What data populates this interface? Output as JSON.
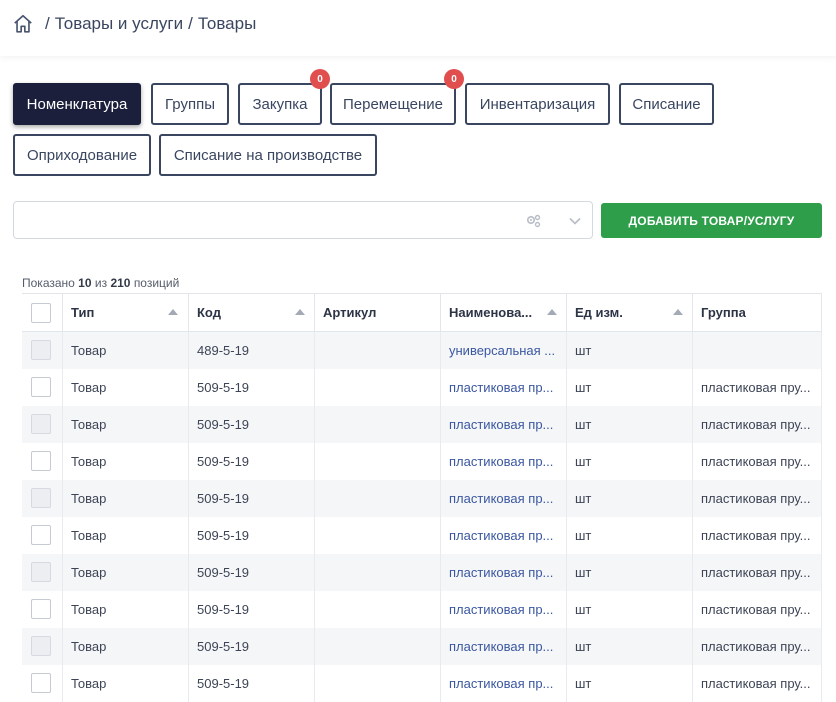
{
  "breadcrumb": {
    "home_icon": "home-icon",
    "parts": [
      "Товары и услуги",
      "Товары"
    ],
    "separator": "/"
  },
  "tabs": [
    {
      "label": "Номенклатура",
      "active": true,
      "badge": null
    },
    {
      "label": "Группы",
      "active": false,
      "badge": null
    },
    {
      "label": "Закупка",
      "active": false,
      "badge": "0"
    },
    {
      "label": "Перемещение",
      "active": false,
      "badge": "0"
    },
    {
      "label": "Инвентаризация",
      "active": false,
      "badge": null
    },
    {
      "label": "Списание",
      "active": false,
      "badge": null
    },
    {
      "label": "Оприходование",
      "active": false,
      "badge": null
    },
    {
      "label": "Списание на производстве",
      "active": false,
      "badge": null
    }
  ],
  "search": {
    "value": "",
    "placeholder": "",
    "settings_icon": "settings-icon",
    "dropdown_icon": "chevron-down-icon"
  },
  "add_button": {
    "label": "ДОБАВИТЬ ТОВАР/УСЛУГУ"
  },
  "summary": {
    "prefix": "Показано",
    "shown": "10",
    "middle": "из",
    "total": "210",
    "suffix": "позиций"
  },
  "colors": {
    "active_tab": "#1b1f3b",
    "add_button": "#2e9e4a",
    "badge": "#e04e4e",
    "link": "#3a57a0"
  },
  "table": {
    "columns": [
      {
        "label": "Тип",
        "sortable": true
      },
      {
        "label": "Код",
        "sortable": true
      },
      {
        "label": "Артикул",
        "sortable": false
      },
      {
        "label": "Наименова...",
        "sortable": true
      },
      {
        "label": "Ед изм.",
        "sortable": true
      },
      {
        "label": "Группа",
        "sortable": false
      }
    ],
    "rows": [
      {
        "type": "Товар",
        "code": "489-5-19",
        "article": "",
        "name": "универсальная ...",
        "unit": "шт",
        "group": ""
      },
      {
        "type": "Товар",
        "code": "509-5-19",
        "article": "",
        "name": "пластиковая пр...",
        "unit": "шт",
        "group": "пластиковая пру..."
      },
      {
        "type": "Товар",
        "code": "509-5-19",
        "article": "",
        "name": "пластиковая пр...",
        "unit": "шт",
        "group": "пластиковая пру..."
      },
      {
        "type": "Товар",
        "code": "509-5-19",
        "article": "",
        "name": "пластиковая пр...",
        "unit": "шт",
        "group": "пластиковая пру..."
      },
      {
        "type": "Товар",
        "code": "509-5-19",
        "article": "",
        "name": "пластиковая пр...",
        "unit": "шт",
        "group": "пластиковая пру..."
      },
      {
        "type": "Товар",
        "code": "509-5-19",
        "article": "",
        "name": "пластиковая пр...",
        "unit": "шт",
        "group": "пластиковая пру..."
      },
      {
        "type": "Товар",
        "code": "509-5-19",
        "article": "",
        "name": "пластиковая пр...",
        "unit": "шт",
        "group": "пластиковая пру..."
      },
      {
        "type": "Товар",
        "code": "509-5-19",
        "article": "",
        "name": "пластиковая пр...",
        "unit": "шт",
        "group": "пластиковая пру..."
      },
      {
        "type": "Товар",
        "code": "509-5-19",
        "article": "",
        "name": "пластиковая пр...",
        "unit": "шт",
        "group": "пластиковая пру..."
      },
      {
        "type": "Товар",
        "code": "509-5-19",
        "article": "",
        "name": "пластиковая пр...",
        "unit": "шт",
        "group": "пластиковая пру..."
      }
    ]
  }
}
